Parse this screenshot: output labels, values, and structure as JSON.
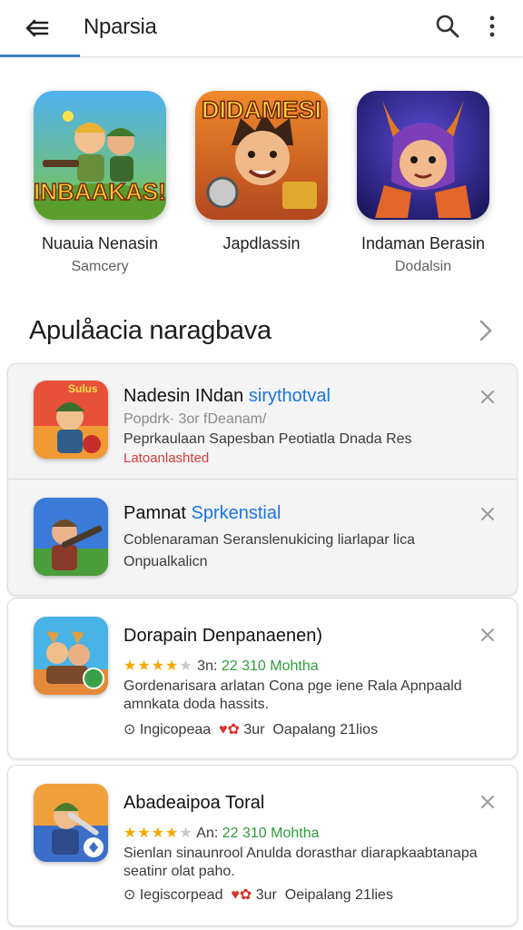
{
  "appbar": {
    "title": "Nparsia",
    "back_icon": "back-arrow-icon",
    "search_icon": "search-icon",
    "more_icon": "more-vert-icon",
    "accent": "#3b82c4"
  },
  "featured": [
    {
      "name": "Nuauia Nenasin",
      "sub": "Samcery",
      "banner": "INBAAKAS!"
    },
    {
      "name": "Japdlassin",
      "sub": "",
      "banner": "DIDAMESI"
    },
    {
      "name": "Indaman Berasin",
      "sub": "Dodalsin",
      "banner": ""
    }
  ],
  "section": {
    "title": "Apulåacia naragbava"
  },
  "cards": [
    {
      "title": "Nadesin INdan",
      "accent_text": "sirythotval",
      "line1": "Popdrk· 3or fDeanam/",
      "line2": "Peprkaulaan Sapesban Peotiatla Dnada Res",
      "line3": "Latoanlashted",
      "icon_badge": "Sulus"
    },
    {
      "title": "Pamnat",
      "accent_text": "Sprkenstial",
      "line1": "Coblenaraman Seranslenukicing liarlapar lica",
      "line2": "Onpualkalicn"
    },
    {
      "title": "Dorapain Denpanaenen)",
      "rating": "4",
      "rating_prefix": "3n:",
      "rating_text": "22 310 Mohtha",
      "desc1": "Gordenarisara arlatan Cona pge iene Rala Apnpaald",
      "desc2": "amnkata doda hassits.",
      "meta1": "Ingicopeaa",
      "meta2": "3ur",
      "meta3": "Oapalang 21lios"
    },
    {
      "title": "Abadeaipoa Toral",
      "rating": "4",
      "rating_prefix": "An:",
      "rating_text": "22 310 Mohtha",
      "desc1": "Sienlan sinaunrool Anulda dorasthar diarapkaabtanapa",
      "desc2": "seatinr olat paho.",
      "meta1": "Iegiscorpead",
      "meta2": "3ur",
      "meta3": "Oeipalang 21lies"
    }
  ]
}
